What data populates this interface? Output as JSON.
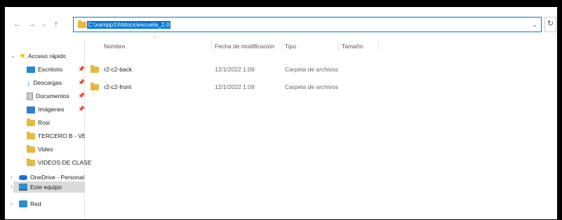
{
  "address": {
    "path": "C:\\xampp1\\htdocs\\escuela_2.0"
  },
  "toolbar": {
    "back_icon": "←",
    "forward_icon": "→",
    "recent_icon": "⌄",
    "up_icon": "↑",
    "refresh_icon": "↻",
    "address_dropdown_icon": "⌄"
  },
  "nav": {
    "quick_access": "Acceso rápido",
    "items": [
      {
        "label": "Escritorio",
        "icon": "desktop-icon",
        "pinned": true
      },
      {
        "label": "Descargas",
        "icon": "download-icon",
        "pinned": true
      },
      {
        "label": "Documentos",
        "icon": "documents-icon",
        "pinned": true
      },
      {
        "label": "Imágenes",
        "icon": "pictures-icon",
        "pinned": true
      },
      {
        "label": "Rosi",
        "icon": "folder-icon",
        "pinned": false
      },
      {
        "label": "TERCERO B - VESPE",
        "icon": "folder-icon",
        "pinned": false
      },
      {
        "label": "Video",
        "icon": "folder-icon",
        "pinned": false
      },
      {
        "label": "VIDEOS DE CLASE",
        "icon": "folder-icon",
        "pinned": false
      }
    ],
    "onedrive": "OneDrive - Personal",
    "this_pc": "Este equipo",
    "network": "Red"
  },
  "columns": {
    "name": "Nombre",
    "modified": "Fecha de modificación",
    "type": "Tipo",
    "size": "Tamaño"
  },
  "files": [
    {
      "name": "r2-c2-back",
      "modified": "12/1/2022 1:09",
      "type": "Carpeta de archivos",
      "size": ""
    },
    {
      "name": "r2-c2-front",
      "modified": "12/1/2022 1:09",
      "type": "Carpeta de archivos",
      "size": ""
    }
  ],
  "colors": {
    "accent": "#0078d7",
    "folder": "#e8b93e",
    "selection": "#dadada"
  }
}
